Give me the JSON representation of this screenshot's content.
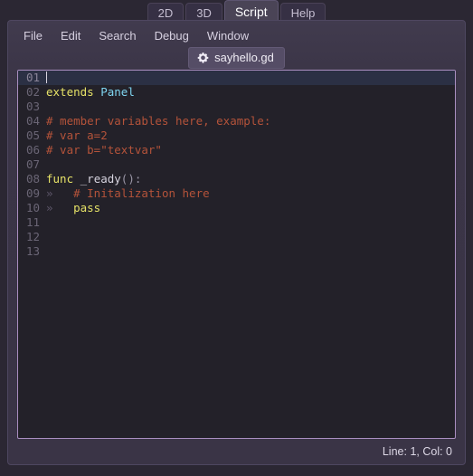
{
  "main_tabs": [
    {
      "label": "2D",
      "active": false
    },
    {
      "label": "3D",
      "active": false
    },
    {
      "label": "Script",
      "active": true
    },
    {
      "label": "Help",
      "active": false
    }
  ],
  "menu": {
    "items": [
      "File",
      "Edit",
      "Search",
      "Debug",
      "Window"
    ]
  },
  "file_tabs": [
    {
      "label": "sayhello.gd",
      "icon": "gear-icon",
      "active": true
    }
  ],
  "editor": {
    "cursor_line": 1,
    "lines": [
      {
        "num": "01",
        "current": true,
        "indent": 0,
        "tokens": []
      },
      {
        "num": "02",
        "current": false,
        "indent": 0,
        "tokens": [
          {
            "t": "extends",
            "c": "kw"
          },
          {
            "t": " ",
            "c": "plain"
          },
          {
            "t": "Panel",
            "c": "type"
          }
        ]
      },
      {
        "num": "03",
        "current": false,
        "indent": 0,
        "tokens": []
      },
      {
        "num": "04",
        "current": false,
        "indent": 0,
        "tokens": [
          {
            "t": "# member variables here, example:",
            "c": "comment"
          }
        ]
      },
      {
        "num": "05",
        "current": false,
        "indent": 0,
        "tokens": [
          {
            "t": "# var a=2",
            "c": "comment"
          }
        ]
      },
      {
        "num": "06",
        "current": false,
        "indent": 0,
        "tokens": [
          {
            "t": "# var b=\"textvar\"",
            "c": "comment"
          }
        ]
      },
      {
        "num": "07",
        "current": false,
        "indent": 0,
        "tokens": []
      },
      {
        "num": "08",
        "current": false,
        "indent": 0,
        "tokens": [
          {
            "t": "func",
            "c": "kw"
          },
          {
            "t": " ",
            "c": "plain"
          },
          {
            "t": "_ready",
            "c": "ident"
          },
          {
            "t": "()",
            "c": "punct"
          },
          {
            "t": ":",
            "c": "punct"
          }
        ]
      },
      {
        "num": "09",
        "current": false,
        "indent": 1,
        "tokens": [
          {
            "t": "# Initalization here",
            "c": "comment"
          }
        ]
      },
      {
        "num": "10",
        "current": false,
        "indent": 1,
        "tokens": [
          {
            "t": "pass",
            "c": "kw"
          }
        ]
      },
      {
        "num": "11",
        "current": false,
        "indent": 0,
        "tokens": []
      },
      {
        "num": "12",
        "current": false,
        "indent": 0,
        "tokens": []
      },
      {
        "num": "13",
        "current": false,
        "indent": 0,
        "tokens": []
      }
    ],
    "indent_guide_glyph": "»"
  },
  "statusbar": {
    "text": "Line: 1, Col: 0"
  },
  "colors": {
    "window_bg": "#2b2733",
    "panel_bg": "#3b3547",
    "editor_bg": "#232129",
    "editor_border": "#a98ec0",
    "current_line": "#2b3044",
    "keyword": "#e6e267",
    "type": "#7fd5f0",
    "comment": "#b4533a",
    "identifier": "#d6d3de",
    "line_number": "#6a6575",
    "active_tab": "#4a4456"
  }
}
